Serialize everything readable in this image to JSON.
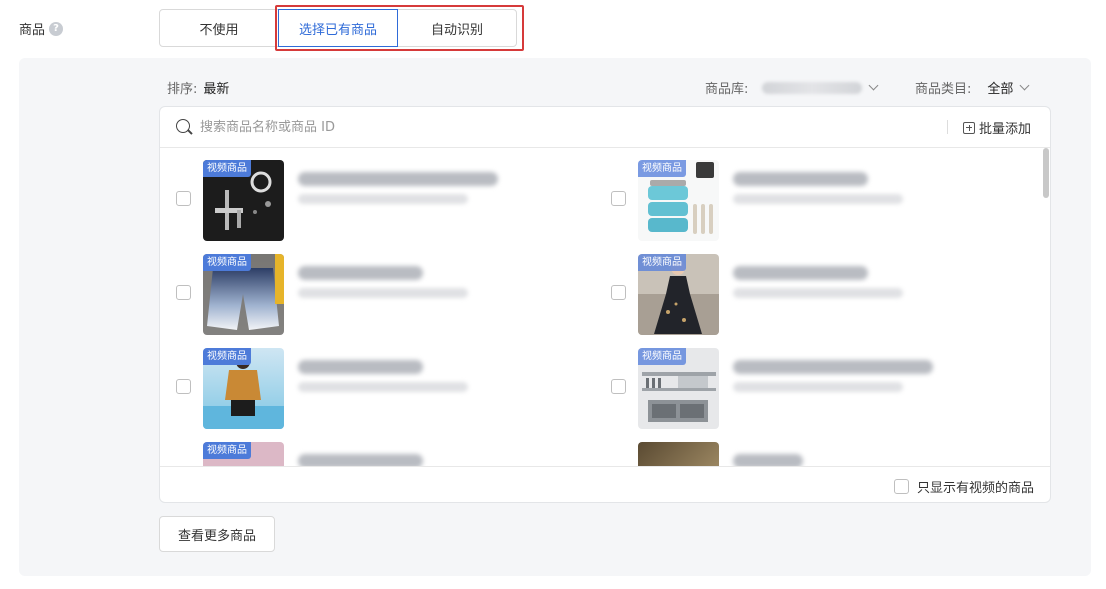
{
  "field": {
    "label": "商品"
  },
  "mode": {
    "options": [
      "不使用",
      "选择已有商品",
      "自动识别"
    ],
    "selected": "选择已有商品"
  },
  "filters": {
    "sort_label": "排序:",
    "sort_value": "最新",
    "library_label": "商品库:",
    "category_label": "商品类目:",
    "category_value": "全部"
  },
  "search": {
    "placeholder": "搜索商品名称或商品 ID",
    "batch_add": "批量添加"
  },
  "tag_text": "视频商品",
  "footer": {
    "only_video": "只显示有视频的商品"
  },
  "more_button": "查看更多商品",
  "colors": {
    "accent": "#2f6bd8",
    "highlight_box": "#d63a3a",
    "tag_bg": "#4d7bd9"
  }
}
